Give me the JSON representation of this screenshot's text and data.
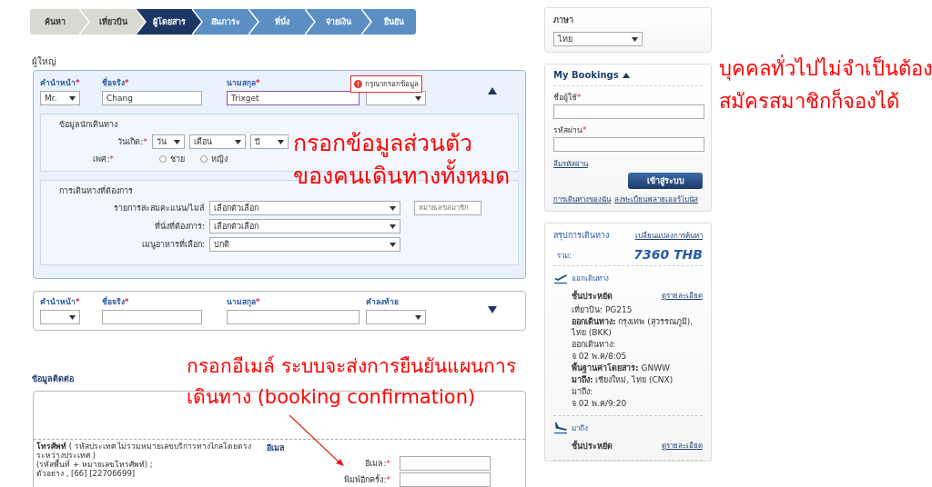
{
  "steps": [
    {
      "label": "ค้นหา",
      "selected": false,
      "completed": true
    },
    {
      "label": "เที่ยวบิน",
      "selected": false,
      "completed": true
    },
    {
      "label": "ผู้โดยสาร",
      "selected": true,
      "completed": false
    },
    {
      "label": "สัมภาระ",
      "selected": false,
      "completed": false
    },
    {
      "label": "ที่นั่ง",
      "selected": false,
      "completed": false
    },
    {
      "label": "จ่ายเงิน",
      "selected": false,
      "completed": false
    },
    {
      "label": "ยืนยัน",
      "selected": false,
      "completed": false
    }
  ],
  "passengers": {
    "heading": "ผู้ใหญ่",
    "annotation": {
      "lines": [
        "กรอกข้อมูลส่วนตัว",
        "ของคนเดินทางทั้งหมด"
      ]
    },
    "forms": [
      {
        "expanded": true,
        "error": "กรุณากรอกข้อมูล",
        "fields": [
          {
            "kind": "select",
            "label": "คำนำหน้า",
            "required_mark": "*",
            "value": "Mr."
          },
          {
            "kind": "text",
            "label": "ชื่อจริง",
            "required_mark": "*",
            "value": "Chang"
          },
          {
            "kind": "text",
            "label": "นามสกุล",
            "required_mark": "*",
            "value": "Trixget",
            "focused": true
          },
          {
            "kind": "select"
          }
        ],
        "traveler_info": {
          "heading": "ข้อมูลนักเดินทาง",
          "birth_label": "วันเกิด:",
          "birth_mark": "*",
          "birth_selects": [
            "วัน",
            "เดือน",
            "ปี"
          ],
          "gender_label": "เพศ:",
          "gender_mark": "*",
          "genders": [
            {
              "label": "ชาย",
              "selected": false
            },
            {
              "label": "หญิง",
              "selected": false
            }
          ]
        },
        "preferences": {
          "heading": "การเดินทางที่ต้องการ",
          "rows": [
            {
              "label": "รายการสะสมคะแนน/ไมล์",
              "value": "เลือกตัวเลือก",
              "member_placeholder": "หมายเลขสมาชิก"
            },
            {
              "label": "ที่นั่งที่ต้องการ:",
              "value": "เลือกตัวเลือก"
            },
            {
              "label": "เมนูอาหารที่เลือก:",
              "value": "ปกติ"
            }
          ]
        }
      },
      {
        "expanded": false,
        "fields": [
          {
            "kind": "select",
            "label": "คำนำหน้า",
            "required_mark": "*"
          },
          {
            "kind": "text",
            "label": "ชื่อจริง",
            "required_mark": "*"
          },
          {
            "kind": "text",
            "label": "นามสกุล",
            "required_mark": "*"
          },
          {
            "kind": "select",
            "label": "คำลงท้าย"
          }
        ]
      }
    ]
  },
  "contact": {
    "heading": "ข้อมูลติดต่อ",
    "annotation": {
      "lines": [
        "กรอกอีเมล์ ระบบจะส่งการยืนยันแผนการ",
        "เดินทาง (booking confirmation)"
      ]
    },
    "phone_lines": [
      "**โทรศัพท์** ( รหัสประเทศ ไม่รวมหมายเลขบริการทางไกลโดยตรงระหว่างประเทศ )",
      "(รหัสพื้นที่ + หมายเลขโทรศัพท์) ;",
      "ตัวอย่าง , [66] [22706699]"
    ],
    "email_heading": "อีเมล",
    "email_fields": [
      {
        "label": "อีเมล:",
        "required_mark": "*"
      },
      {
        "label": "พิมพ์อีกครั้ง:",
        "required_mark": "*"
      }
    ]
  },
  "sidebar": {
    "language": {
      "label": "ภาษา",
      "value": "ไทย"
    },
    "annotation": {
      "lines": [
        "บุคคลทั่วไปไม่จำเป็นต้อง",
        "สมัครสมาชิกก็จองได้"
      ]
    },
    "my_bookings": {
      "title": "My Bookings",
      "expanded": true,
      "fields": [
        {
          "label": "ชื่อผู้ใช้",
          "required_mark": "*"
        },
        {
          "label": "รหัสผ่าน",
          "required_mark": "*"
        }
      ],
      "forgot_link": "ลืมรหัสผ่าน",
      "login_button": "เข้าสู่ระบบ",
      "links": [
        "การเดินทางของฉัน",
        "ลงทะเบียนฟลายเออร์โบนัส"
      ]
    },
    "summary": {
      "title": "สรุปการเดินทาง",
      "change_link": "เปลี่ยนแปลงการค้นหา",
      "total_label": "รวม:",
      "total": "7360 THB",
      "segments": [
        {
          "kind": "departure",
          "heading": "ออกเดินทาง",
          "cabin": "ชั้นประหยัด",
          "details_link": "ดูรายละเอียด",
          "details": [
            "เที่ยวบิน: PG215",
            "**ออกเดินทาง:** กรุงเทพ (สุวรรณภูมิ), ไทย (BKK)",
            "ออกเดินทาง:",
            "จ 02 พ.ค/8:05",
            "**พื้นฐานค่าโดยสาร:** GNWW",
            "**มาถึง:** เชียงใหม่, ไทย (CNX)",
            "มาถึง:",
            "จ 02 พ.ค/9:20"
          ]
        },
        {
          "kind": "arrival",
          "heading": "มาถึง",
          "cabin": "ชั้นประหยัด",
          "details_link": "ดูรายละเอียด"
        }
      ]
    }
  }
}
